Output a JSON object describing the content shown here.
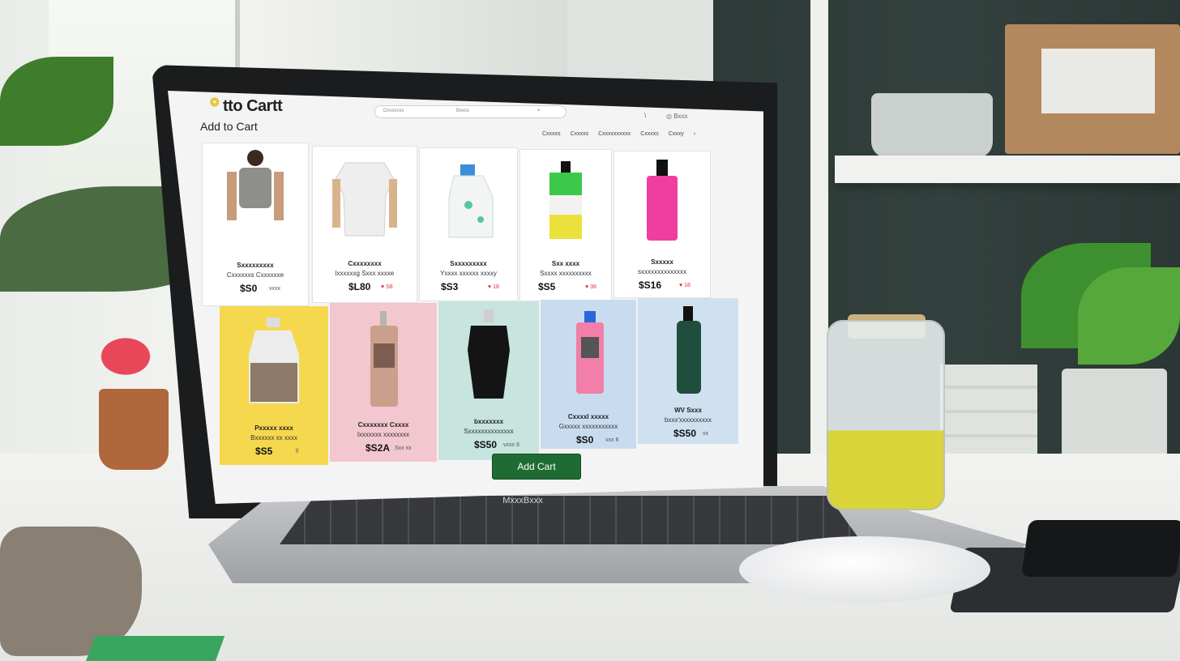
{
  "site": {
    "logo_title": "tto Cartt",
    "subtitle": "Add to Cart",
    "search_left": "Dxxxxxxx",
    "search_mid": "Bxxxx",
    "header_icon_1": "\\",
    "header_icon_2": "◎ Bxxx"
  },
  "nav": [
    "Cxxxxs",
    "Cxxxxs",
    "Cxxxxxxxxxx",
    "Cxxxxs",
    "Cxxxy",
    "›"
  ],
  "products_top": [
    {
      "name": "Sxxxxxxxxx",
      "desc": "Cxxxxxxs Cxxxxxxe",
      "price": "$S0",
      "extra": "vxxx",
      "image": "grey-tshirt-mannequin"
    },
    {
      "name": "Cxxxxxxxx",
      "desc": "lxxxxxxg Sxxx xxxxe",
      "price": "$L80",
      "extra": "♥ S8",
      "image": "white-tshirt-mannequin"
    },
    {
      "name": "Sxxxxxxxxx",
      "desc": "Yxxxx xxxxxx xxxxy",
      "price": "$S3",
      "extra": "♥ 18",
      "image": "white-spray-bottle"
    },
    {
      "name": "Sxx xxxx",
      "desc": "Sxxxx xxxxxxxxxx",
      "price": "$S5",
      "extra": "♥ 38",
      "image": "green-yellow-bottle"
    },
    {
      "name": "Sxxxxx",
      "desc": "sxxxxxxxxxxxxxx",
      "price": "$S16",
      "extra": "♥ 18",
      "image": "pink-bottle"
    }
  ],
  "products_bottom": [
    {
      "name": "Pxxxxx xxxx",
      "desc": "Bxxxxxx xx xxxx",
      "price": "$S5",
      "extra": "ll",
      "bg": "#f6d84e",
      "image": "white-jug"
    },
    {
      "name": "Cxxxxxxx Cxxxx",
      "desc": "lxxxxxxx xxxxxxxx",
      "price": "$S2A",
      "extra": "Sxx xx",
      "bg": "#f3c7cf",
      "image": "pump-bottle"
    },
    {
      "name": "bxxxxxxx",
      "desc": "Sxxxxxxxxxxxxxx",
      "price": "$S50",
      "extra": "vxxx 8",
      "bg": "#c7e4de",
      "image": "black-top-mannequin"
    },
    {
      "name": "Cxxxxl xxxxx",
      "desc": "Gxxxxx xxxxxxxxxxx",
      "price": "$S0",
      "extra": "vxx 8",
      "bg": "#c9dcef",
      "image": "pink-lotion-bottle"
    },
    {
      "name": "WV Sxxx",
      "desc": "bxxx'xxxxxxxxxx",
      "price": "$S50",
      "extra": "vx",
      "bg": "#cfe0f1",
      "image": "dark-green-bottle"
    }
  ],
  "cta": {
    "label": "Add Cart"
  },
  "laptop": {
    "brand": "MxxxBxxx"
  },
  "colors": {
    "cta": "#1f6b34",
    "heart": "#d33333"
  }
}
